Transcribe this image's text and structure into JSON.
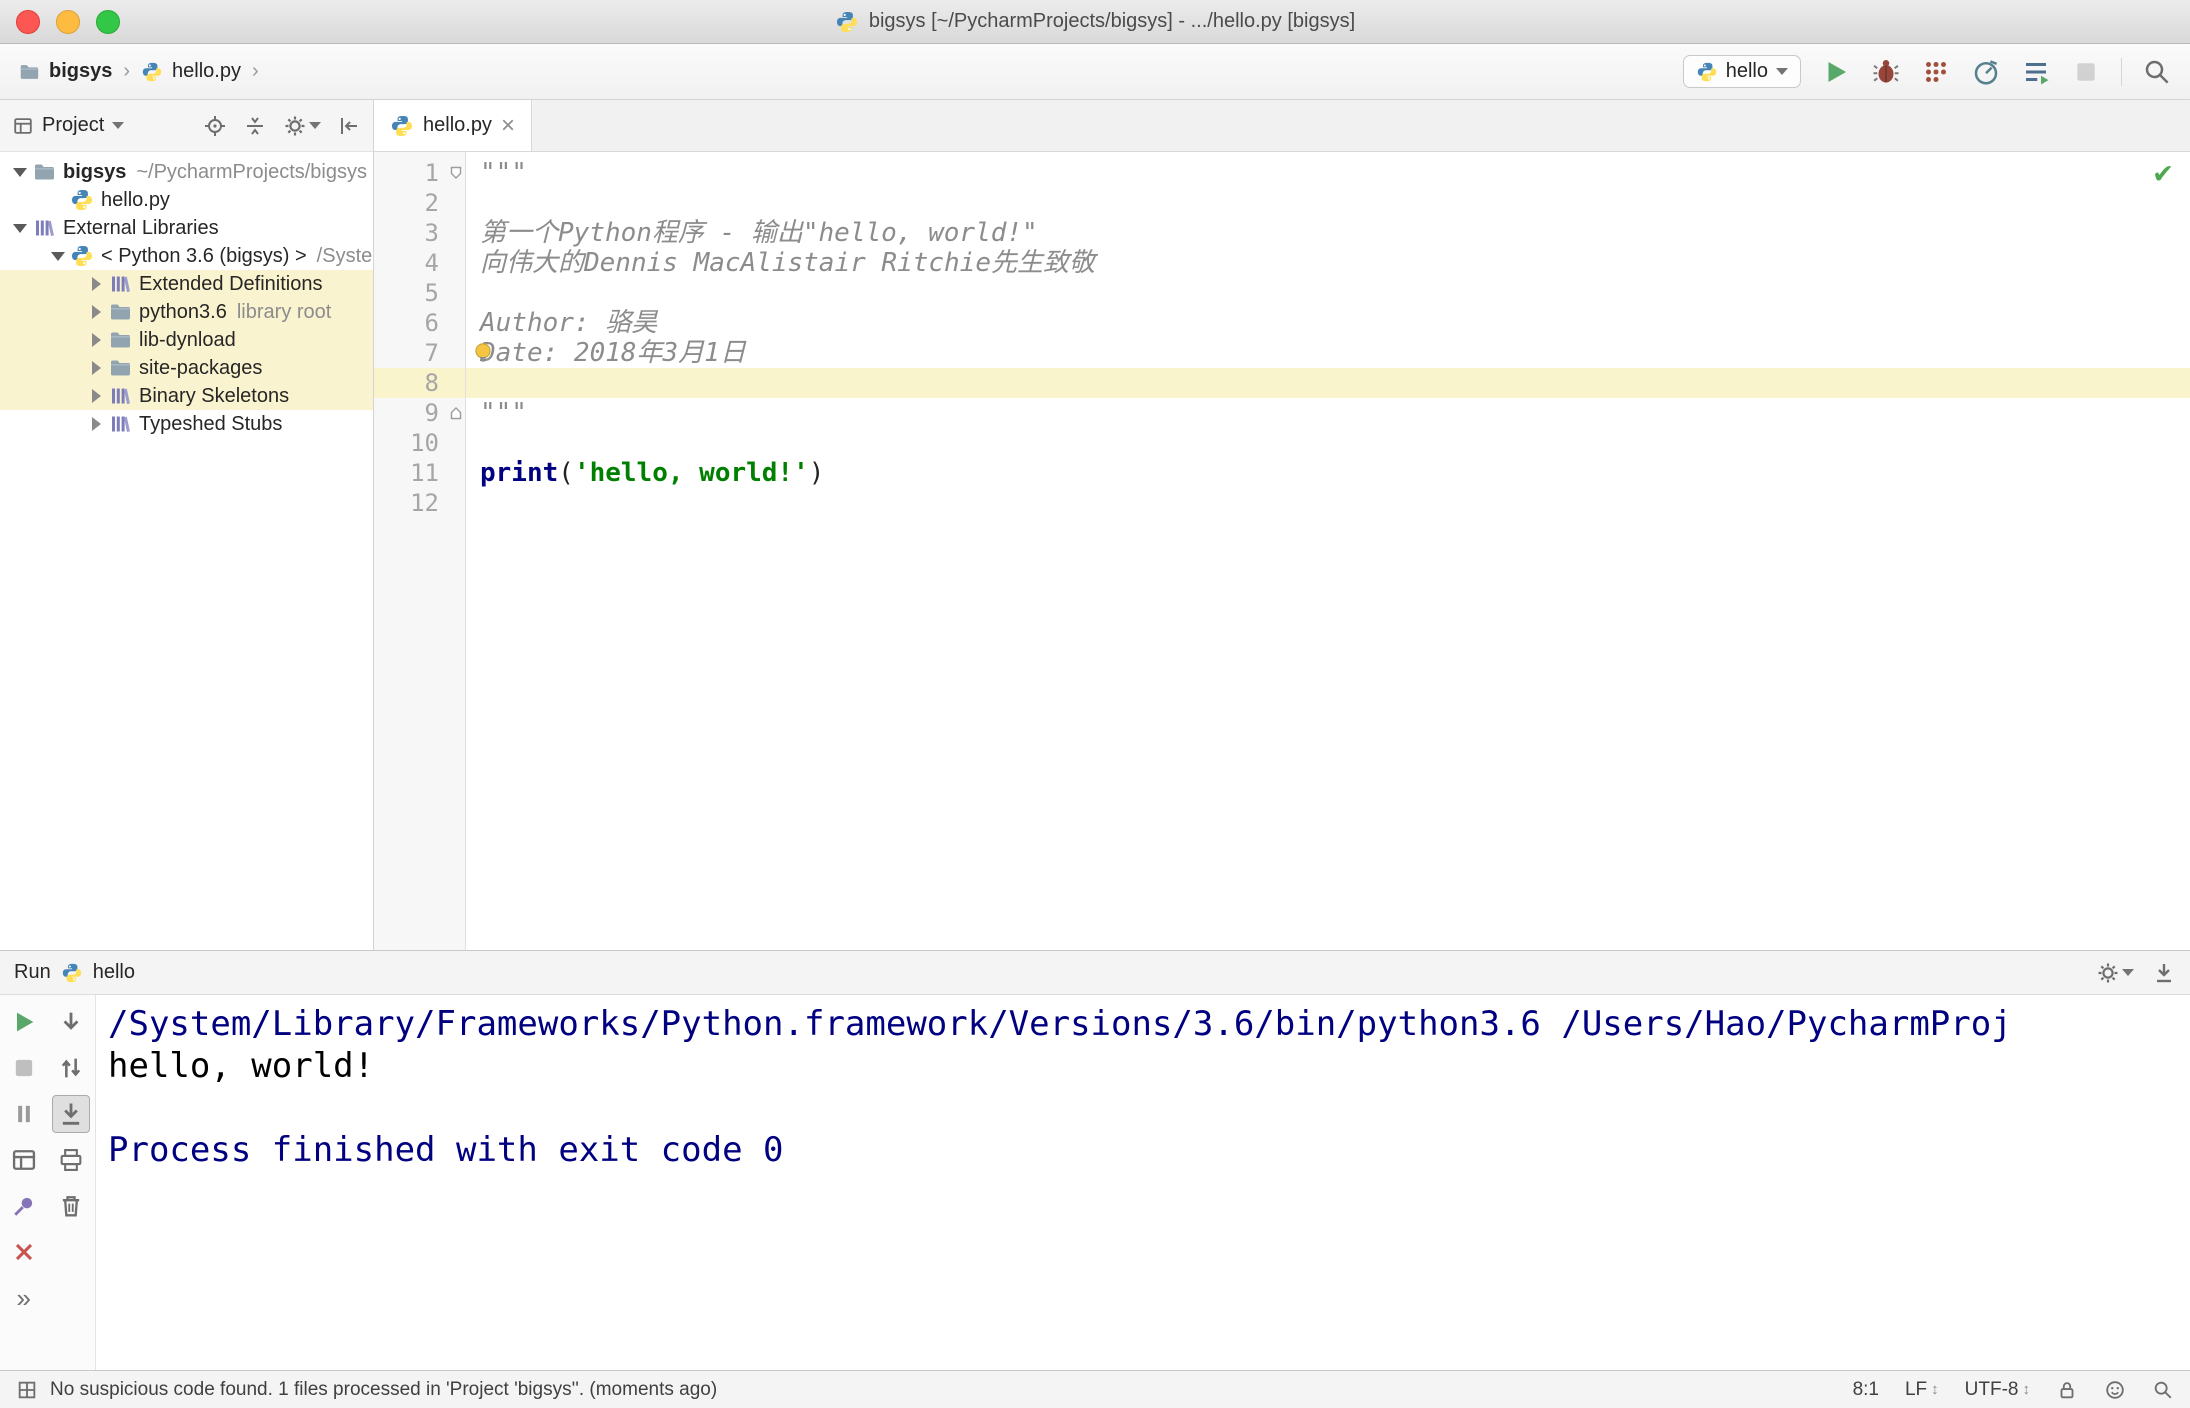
{
  "icons": {
    "close": "×",
    "more": "»",
    "check": "✔",
    "updown": "↕"
  },
  "colors": {
    "keyword": "#000080",
    "string": "#008000",
    "caret_row": "#FAF4CC",
    "tree_highlight": "#FAF3CF",
    "console_info": "#000080",
    "run_green": "#59A869"
  },
  "window": {
    "title": "bigsys [~/PycharmProjects/bigsys] - .../hello.py [bigsys]"
  },
  "breadcrumb": {
    "separator": "›",
    "items": [
      {
        "label": "bigsys"
      },
      {
        "label": "hello.py"
      }
    ]
  },
  "toolbar": {
    "run_config": "hello"
  },
  "project": {
    "title": "Project",
    "items": [
      {
        "label": "bigsys",
        "suffix": "~/PycharmProjects/bigsys"
      },
      {
        "label": "hello.py"
      },
      {
        "label": "External Libraries"
      },
      {
        "label": "< Python 3.6 (bigsys) >",
        "suffix": "/System"
      },
      {
        "label": "Extended Definitions"
      },
      {
        "label": "python3.6",
        "suffix": "library root"
      },
      {
        "label": "lib-dynload"
      },
      {
        "label": "site-packages"
      },
      {
        "label": "Binary Skeletons"
      },
      {
        "label": "Typeshed Stubs"
      }
    ]
  },
  "editor": {
    "tab": "hello.py",
    "lines": [
      {
        "n": "1",
        "doc": "\"\"\""
      },
      {
        "n": "2"
      },
      {
        "n": "3",
        "doc": "第一个Python程序 - 输出\"hello, world!\""
      },
      {
        "n": "4",
        "doc": "向伟大的Dennis MacAlistair Ritchie先生致敬"
      },
      {
        "n": "5"
      },
      {
        "n": "6",
        "doc": "Author: 骆昊"
      },
      {
        "n": "7",
        "doc": "Date: 2018年3月1日"
      },
      {
        "n": "8"
      },
      {
        "n": "9",
        "doc": "\"\"\""
      },
      {
        "n": "10"
      },
      {
        "n": "11",
        "kw": "print",
        "p1": "(",
        "str": "'hello, world!'",
        "p2": ")"
      },
      {
        "n": "12"
      }
    ]
  },
  "run": {
    "title": "Run",
    "config": "hello",
    "console": [
      {
        "text": "/System/Library/Frameworks/Python.framework/Versions/3.6/bin/python3.6 /Users/Hao/PycharmProj"
      },
      {
        "text": "hello, world!"
      },
      {
        "text": ""
      },
      {
        "text": "Process finished with exit code 0"
      }
    ]
  },
  "status": {
    "message": "No suspicious code found. 1 files processed in 'Project 'bigsys''. (moments ago)",
    "caret": "8:1",
    "line_ending": "LF",
    "encoding": "UTF-8"
  }
}
